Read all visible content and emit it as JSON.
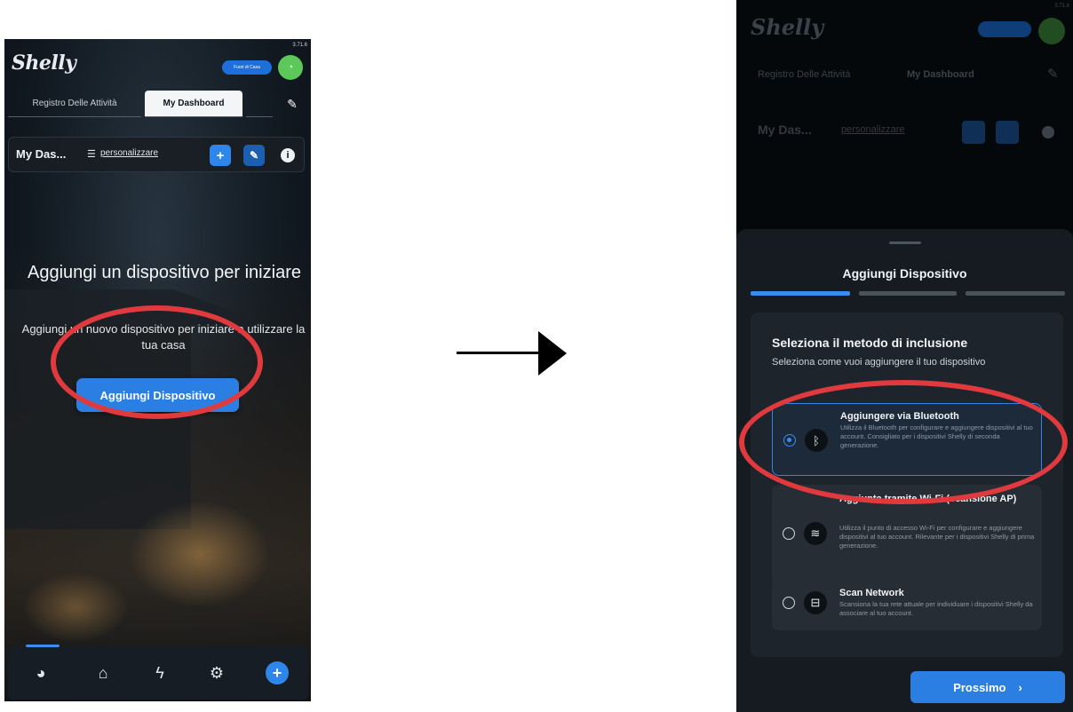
{
  "left_screen": {
    "version": "3.71.6",
    "logo": "Shelly",
    "top_button": "Fuori di Casa",
    "tabs": [
      "Registro Delle Attività",
      "My Dashboard"
    ],
    "dashboard_name": "My Das...",
    "customize_label": "personalizzare",
    "empty_title": "Aggiungi un dispositivo per iniziare",
    "empty_subtitle": "Aggiungi un nuovo dispositivo per iniziare a utilizzare la tua casa",
    "add_device_button": "Aggiungi Dispositivo",
    "bottom_nav": [
      "dashboard-icon",
      "home-icon",
      "lightning-icon",
      "settings-icon",
      "add-icon"
    ]
  },
  "right_screen": {
    "version": "3.71.6",
    "logo": "Shelly",
    "tabs": [
      "Registro Delle Attività",
      "My Dashboard"
    ],
    "dashboard_name": "My Das...",
    "customize_label": "personalizzare",
    "sheet_title": "Aggiungi Dispositivo",
    "steps_total": 3,
    "current_step": 1,
    "card_title": "Seleziona il metodo di inclusione",
    "card_subtitle": "Seleziona come vuoi aggiungere il tuo dispositivo",
    "options": [
      {
        "name": "Aggiungere via Bluetooth",
        "description": "Utilizza il Bluetooth per configurare e aggiungere dispositivi al tuo account. Consigliato per i dispositivi Shelly di seconda generazione.",
        "icon": "bluetooth-icon",
        "selected": true
      },
      {
        "name": "Aggiunta tramite Wi-Fi (scansione AP)",
        "description": "Utilizza il punto di accesso Wi-Fi per configurare e aggiungere dispositivi al tuo account. Rilevante per i dispositivi Shelly di prima generazione.",
        "icon": "wifi-icon",
        "selected": false
      },
      {
        "name": "Scan Network",
        "description": "Scansiona la tua rete attuale per individuare i dispositivi Shelly da associare al tuo account.",
        "icon": "router-icon",
        "selected": false
      }
    ],
    "next_button": "Prossimo",
    "next_chevron": "›"
  },
  "colors": {
    "accent": "#2b7fe3",
    "highlight": "#e0393e",
    "avatar": "#5cc85a"
  }
}
